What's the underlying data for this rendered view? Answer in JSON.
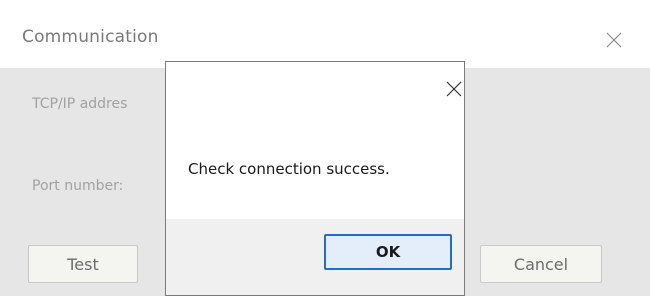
{
  "parent_dialog": {
    "title": "Communication",
    "close_icon": "close-icon",
    "tcp_label": "TCP/IP addres",
    "port_label": "Port number:",
    "test_label": "Test",
    "cancel_label": "Cancel"
  },
  "message_box": {
    "close_icon": "close-icon",
    "message": "Check connection success.",
    "ok_label": "OK"
  },
  "colors": {
    "parent_body_bg": "#e6e6e6",
    "ok_button_border": "#1f6fd1",
    "ok_button_bg": "#e4eefb"
  }
}
